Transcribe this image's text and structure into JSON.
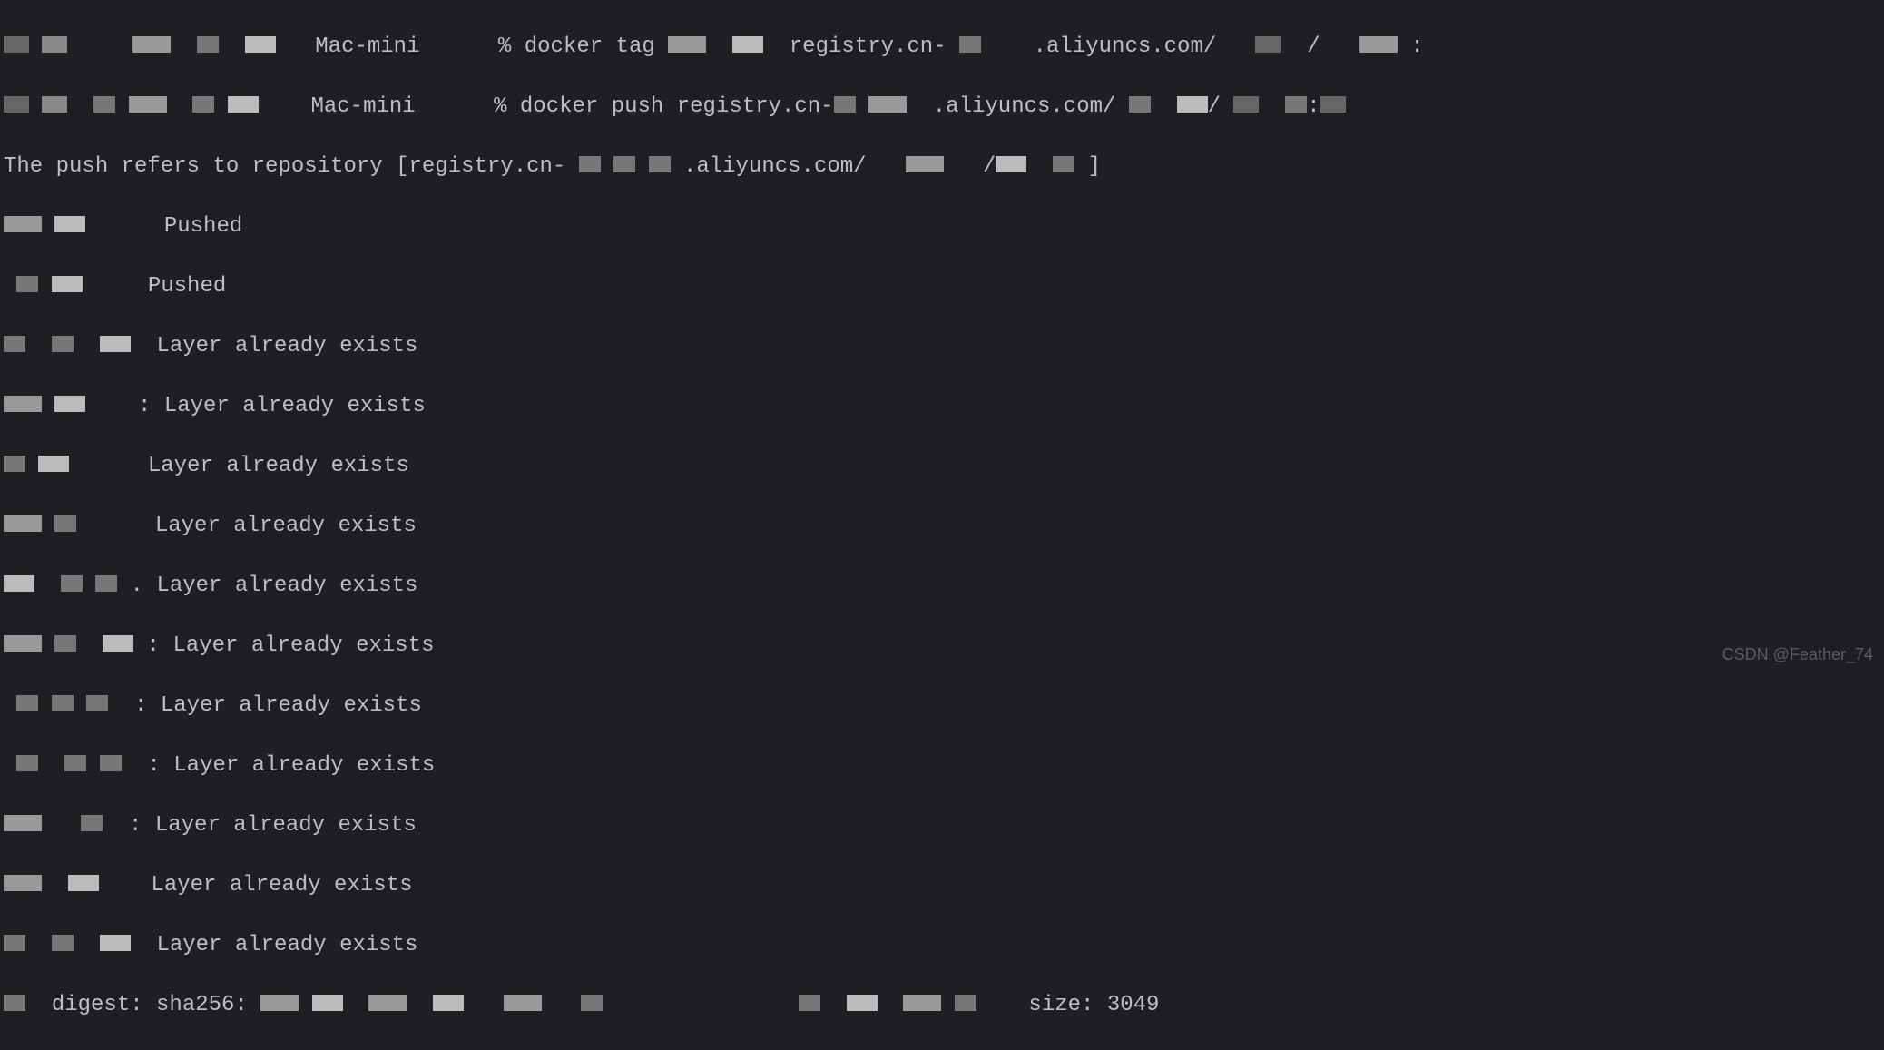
{
  "term": {
    "hostname": "Mac-mini",
    "promptChar": "%",
    "cmd_tag_prefix": "docker tag",
    "cmd_push_prefix": "docker push registry.cn-",
    "registry_frag1": "registry.cn-",
    "registry_frag2": ".aliyuncs.com/",
    "push_refers_prefix": "The push refers to repository [registry.cn-",
    "push_refers_mid": ".aliyuncs.com/",
    "push_refers_suffix": "]",
    "layers": [
      {
        "status": "Pushed"
      },
      {
        "status": "Pushed"
      },
      {
        "status": "Layer already exists"
      },
      {
        "status": "Layer already exists"
      },
      {
        "status": "Layer already exists"
      },
      {
        "status": "Layer already exists"
      },
      {
        "status": "Layer already exists"
      },
      {
        "status": "Layer already exists"
      },
      {
        "status": "Layer already exists"
      },
      {
        "status": "Layer already exists"
      },
      {
        "status": "Layer already exists"
      },
      {
        "status": "Layer already exists"
      },
      {
        "status": "Layer already exists"
      }
    ],
    "digest_label": "digest: sha256:",
    "size_label": "size:",
    "size_value": "3049",
    "colon": ":",
    "dot": ".",
    "slash": "/"
  },
  "watermark": "CSDN @Feather_74"
}
